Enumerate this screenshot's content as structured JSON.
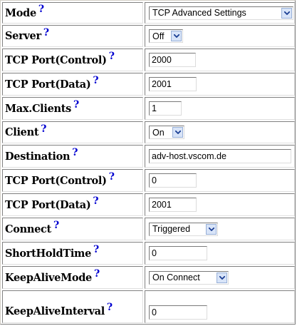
{
  "help_glyph": "?",
  "rows": [
    {
      "label": "Mode",
      "type": "select",
      "value": "TCP Advanced Settings"
    },
    {
      "label": "Server",
      "type": "select",
      "value": "Off"
    },
    {
      "label": "TCP Port(Control)",
      "type": "input",
      "value": "2000"
    },
    {
      "label": "TCP Port(Data)",
      "type": "input",
      "value": "2001"
    },
    {
      "label": "Max.Clients",
      "type": "input",
      "value": "1"
    },
    {
      "label": "Client",
      "type": "select",
      "value": "On"
    },
    {
      "label": "Destination",
      "type": "input",
      "value": "adv-host.vscom.de"
    },
    {
      "label": "TCP Port(Control)",
      "type": "input",
      "value": "0"
    },
    {
      "label": "TCP Port(Data)",
      "type": "input",
      "value": "2001"
    },
    {
      "label": "Connect",
      "type": "select",
      "value": "Triggered"
    },
    {
      "label": "ShortHoldTime",
      "type": "input",
      "value": "0"
    },
    {
      "label": "KeepAliveMode",
      "type": "select",
      "value": "On Connect"
    },
    {
      "label": "KeepAliveInterval",
      "type": "input",
      "value": "0"
    }
  ],
  "colors": {
    "help": "#0000d0",
    "arrow_bg": "#d8e4f8"
  }
}
